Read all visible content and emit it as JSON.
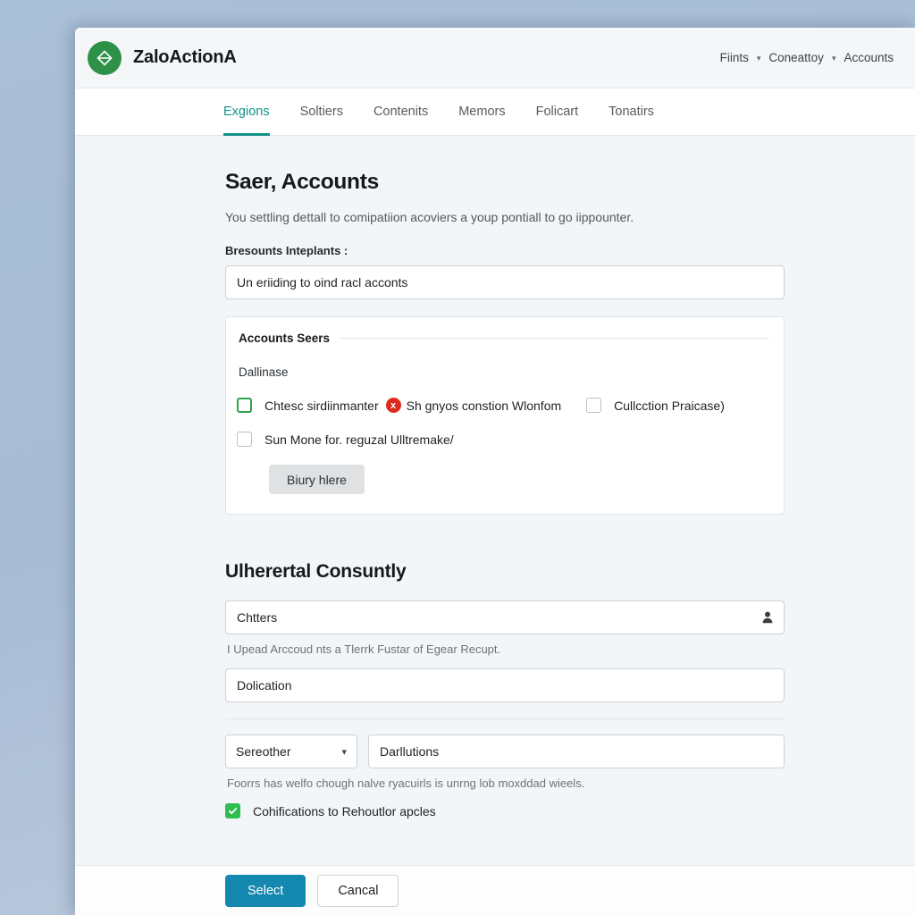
{
  "brand": {
    "logo_icon": "diamond-split-icon",
    "logo_color": "#2e9148",
    "title": "ZaloActionA",
    "nav": [
      {
        "label": "Fiints",
        "has_caret": true
      },
      {
        "label": "Coneattoy",
        "has_caret": true
      },
      {
        "label": "Accounts",
        "has_caret": false
      }
    ]
  },
  "tabs": [
    {
      "label": "Exgions",
      "active": true
    },
    {
      "label": "Soltiers",
      "active": false
    },
    {
      "label": "Contenits",
      "active": false
    },
    {
      "label": "Memors",
      "active": false
    },
    {
      "label": "Folicart",
      "active": false
    },
    {
      "label": "Tonatirs",
      "active": false
    }
  ],
  "accent_colors": {
    "tab_active": "#139287",
    "primary_button": "#1588b0",
    "success": "#2fbd51",
    "error": "#dd2b20"
  },
  "main": {
    "title": "Saer, Accounts",
    "subtitle": "You settling dettall to comipatiion acoviers a youp pontiall to go iippounter.",
    "field_label": "Bresounts Inteplants :",
    "primary_input_value": "Un eriiding to oind racl acconts",
    "card": {
      "legend": "Accounts Seers",
      "note": "Dallinase",
      "checkbox_row": [
        {
          "label": "Chtesc sirdiinmanter",
          "state": "unchecked-green-outline",
          "badge": "x",
          "badge_text": "Sh gnyos constion Wlonfom"
        },
        {
          "label": "Cullcction Praicase)",
          "state": "unchecked"
        }
      ],
      "checkbox_second": {
        "label": "Sun Mone for. reguzal  Ulltremake/",
        "state": "unchecked"
      },
      "button_label": "Biury hlere"
    }
  },
  "section2": {
    "title": "Ulherertal Consuntly",
    "input_with_icon": {
      "value": "Chtters",
      "icon": "user-icon"
    },
    "helper_1": "I Upead Arccoud nts a Tlerrk Fustar of Egear Recupt.",
    "input_2_value": "Dolication",
    "select_value": "Sereother",
    "select_caret_icon": "chevron-down-icon",
    "input_3_value": "Darllutions",
    "helper_2": "Foorrs has welfo chough nalve ryacuirls is unrng lob moxddad wieels.",
    "consent": {
      "label": "Cohifications to Rehoutlor apcles",
      "state": "checked"
    }
  },
  "footer": {
    "submit_label": "Select",
    "cancel_label": "Cancal"
  }
}
